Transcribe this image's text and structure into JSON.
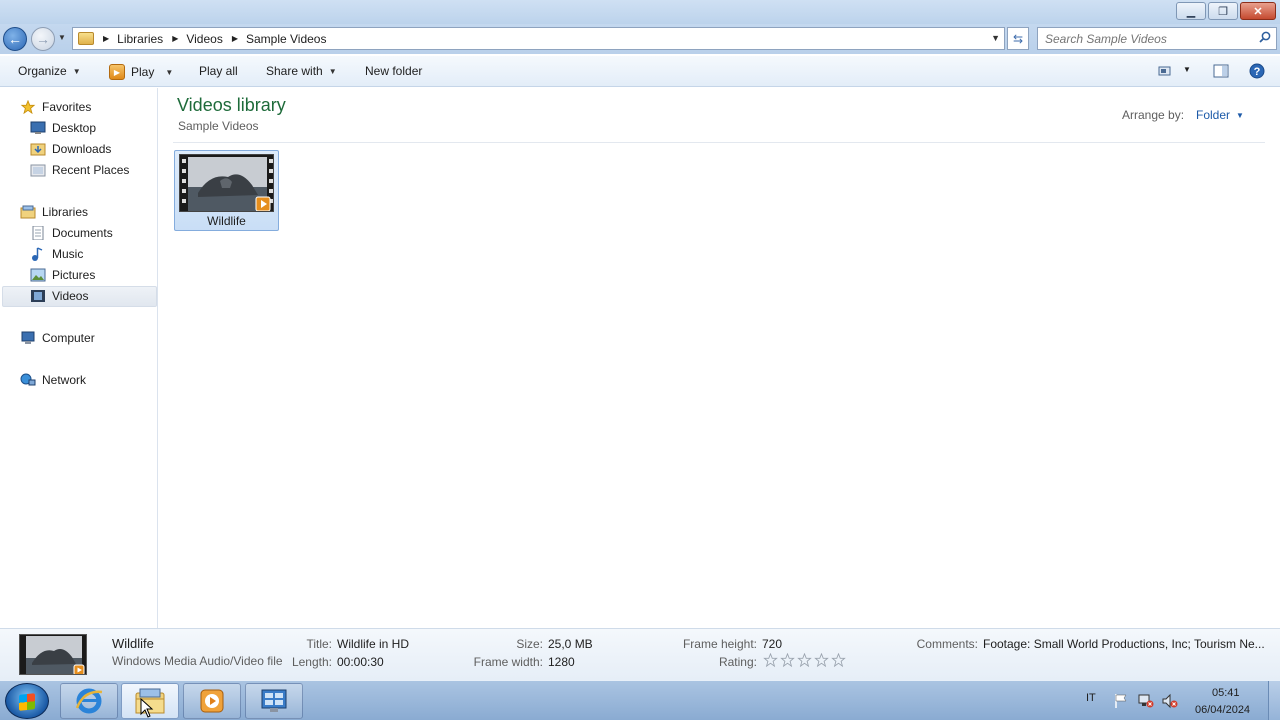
{
  "address": {
    "crumbs": [
      "Libraries",
      "Videos",
      "Sample Videos"
    ],
    "search_placeholder": "Search Sample Videos"
  },
  "toolbar": {
    "organize": "Organize",
    "play": "Play",
    "play_all": "Play all",
    "share_with": "Share with",
    "new_folder": "New folder"
  },
  "navpane": {
    "favorites": "Favorites",
    "desktop": "Desktop",
    "downloads": "Downloads",
    "recent_places": "Recent Places",
    "libraries": "Libraries",
    "documents": "Documents",
    "music": "Music",
    "pictures": "Pictures",
    "videos": "Videos",
    "computer": "Computer",
    "network": "Network"
  },
  "content": {
    "library_title": "Videos library",
    "library_subtitle": "Sample Videos",
    "arrange_label": "Arrange by:",
    "arrange_value": "Folder",
    "items": [
      {
        "name": "Wildlife"
      }
    ]
  },
  "details": {
    "name": "Wildlife",
    "type": "Windows Media Audio/Video file",
    "title_label": "Title:",
    "title_value": "Wildlife in HD",
    "length_label": "Length:",
    "length_value": "00:00:30",
    "size_label": "Size:",
    "size_value": "25,0 MB",
    "frame_width_label": "Frame width:",
    "frame_width_value": "1280",
    "frame_height_label": "Frame height:",
    "frame_height_value": "720",
    "rating_label": "Rating:",
    "rating_stars": 0,
    "comments_label": "Comments:",
    "comments_value": "Footage: Small World Productions, Inc; Tourism Ne..."
  },
  "taskbar": {
    "language": "IT",
    "time": "05:41",
    "date": "06/04/2024"
  }
}
